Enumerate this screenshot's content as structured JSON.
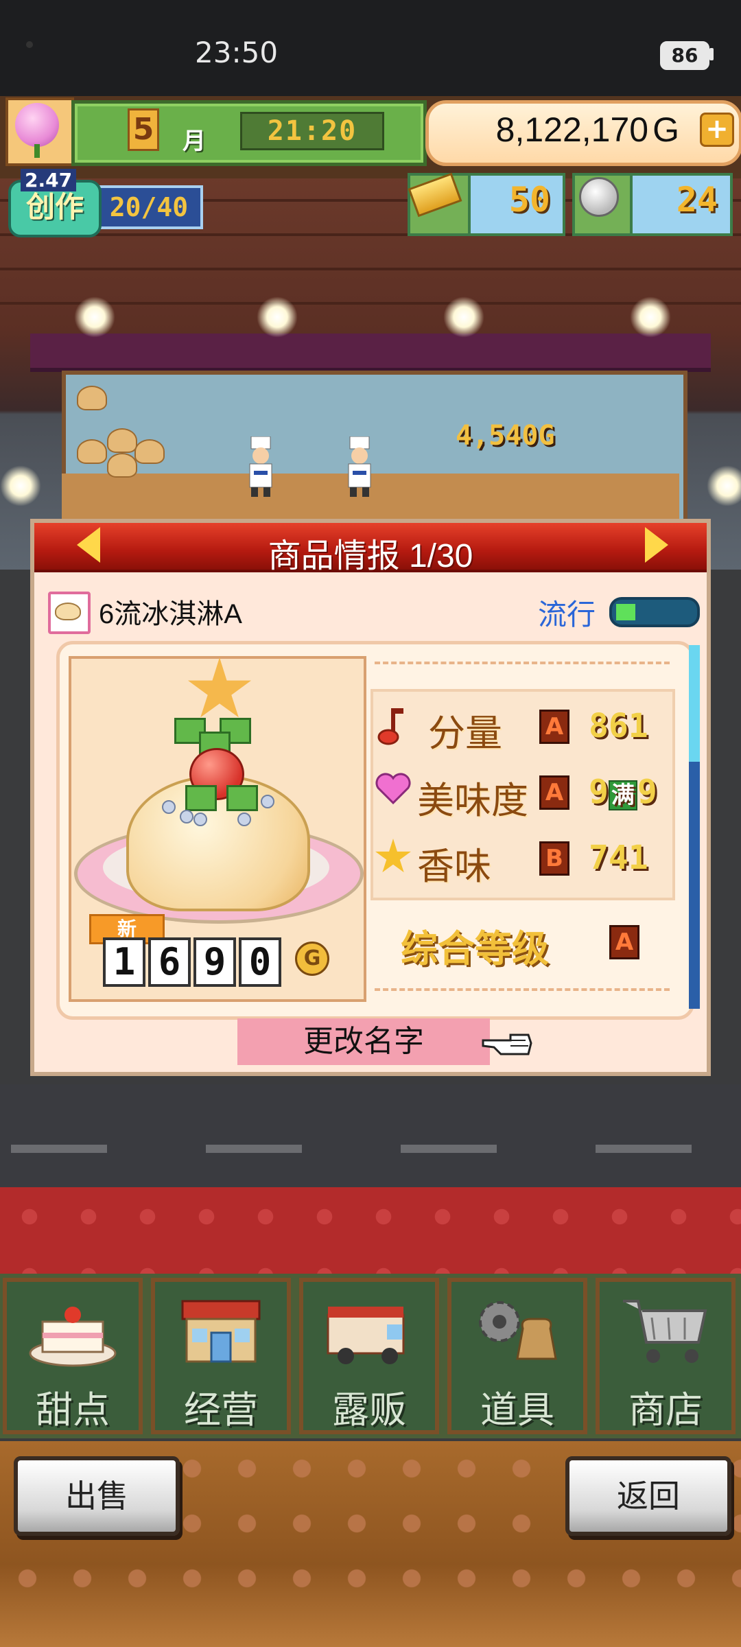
{
  "status_bar": {
    "time": "23:50",
    "battery": "86"
  },
  "hud": {
    "month_number": "5",
    "month_label": "月",
    "game_time": "21:20",
    "money": "8,122,170",
    "money_unit": "G",
    "create_badge_label": "创作",
    "create_level": "2.47",
    "create_count": "20/40",
    "gold_bars": "50",
    "medals": "24"
  },
  "scene": {
    "floating_money": "4,540G"
  },
  "dialog": {
    "title": "商品情报 1/30",
    "item_name": "6流冰淇淋A",
    "trend_label": "流行",
    "trend_level": 0.25,
    "new_tag": "新",
    "price_digits": [
      "1",
      "6",
      "9",
      "0"
    ],
    "price_unit": "G",
    "stats": [
      {
        "label": "分量",
        "grade": "A",
        "value": "861"
      },
      {
        "label": "美味度",
        "grade": "A",
        "value_prefix": "9",
        "value_tag": "满",
        "value_suffix": "9"
      },
      {
        "label": "香味",
        "grade": "B",
        "value": "741"
      }
    ],
    "overall_label": "综合等级",
    "overall_grade": "A",
    "rename_button": "更改名字"
  },
  "menu": [
    {
      "label": "甜点",
      "icon": "cake-icon"
    },
    {
      "label": "经营",
      "icon": "shop-icon"
    },
    {
      "label": "露贩",
      "icon": "food-truck-icon"
    },
    {
      "label": "道具",
      "icon": "gear-bag-icon"
    },
    {
      "label": "商店",
      "icon": "cart-icon"
    }
  ],
  "footer": {
    "sell_button": "出售",
    "back_button": "返回"
  }
}
